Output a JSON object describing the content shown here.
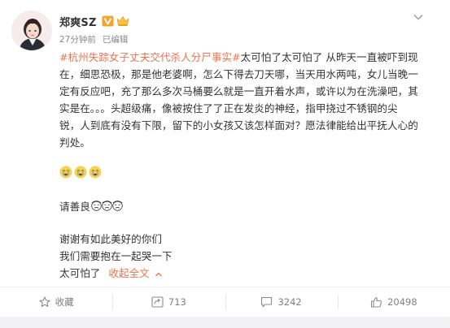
{
  "post": {
    "user_name": "郑爽SZ",
    "time": "27分钟前",
    "edited": "已编辑",
    "topic": "#杭州失踪女子丈夫交代杀人分尸事实#",
    "body_lines": [
      "太可怕了太可怕了 从昨天一直被吓到现",
      "在，细思恐极，那是他老婆啊，怎么下得去刀天哪，当天用水两吨，女儿当晚一",
      "定有反应吧，充了那么多次马桶要么就是一直开着水声，或许以为在洗澡吧，其",
      "实是在。。。头超级痛，像被按住了了正在发炎的神经，指甲挠过不锈钢的尖",
      "锐，人到底有没有下限，留下的小女孩又该怎样面对？愿法律能给出平抚人心的",
      "判处。"
    ],
    "line_kind": "请善良",
    "tail_lines": [
      "谢谢有如此美好的你们",
      "我们需要抱在一起哭一下",
      "太可怕了"
    ],
    "collapse_label": "收起全文"
  },
  "actions": {
    "favorite_label": "收藏",
    "repost_count": "713",
    "comment_count": "3242",
    "like_count": "20498"
  },
  "icons": {
    "more": "chevron-down-icon",
    "favorite": "star-icon",
    "repost": "repost-icon",
    "comment": "comment-icon",
    "like": "thumbs-up-icon"
  },
  "colors": {
    "accent": "#eb7350",
    "text": "#333333",
    "muted": "#808080"
  }
}
